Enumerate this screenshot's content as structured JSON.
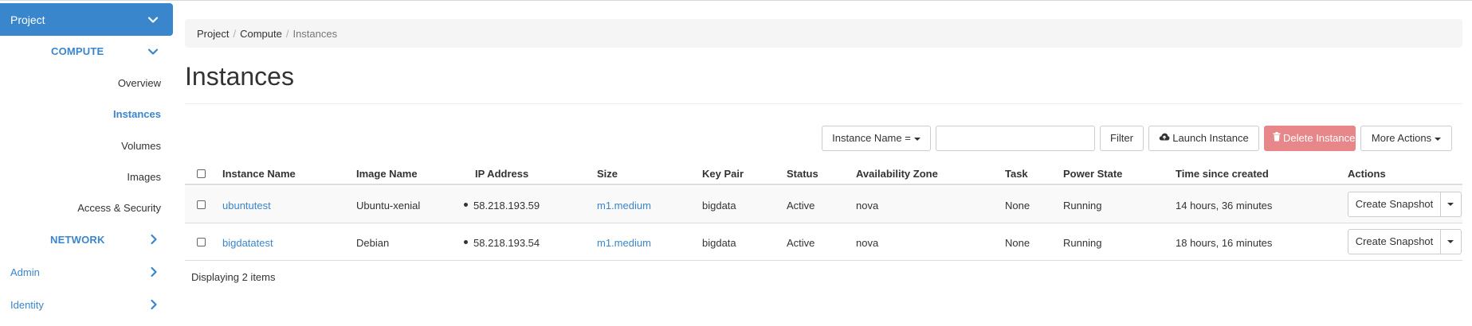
{
  "sidebar": {
    "project_label": "Project",
    "compute_label": "COMPUTE",
    "compute_items": [
      {
        "label": "Overview",
        "active": false
      },
      {
        "label": "Instances",
        "active": true
      },
      {
        "label": "Volumes",
        "active": false
      },
      {
        "label": "Images",
        "active": false
      },
      {
        "label": "Access & Security",
        "active": false
      }
    ],
    "network_label": "NETWORK",
    "admin_label": "Admin",
    "identity_label": "Identity",
    "accent_color": "#3a86cc"
  },
  "breadcrumb": {
    "items": [
      "Project",
      "Compute",
      "Instances"
    ],
    "separator": "/"
  },
  "page": {
    "title": "Instances"
  },
  "toolbar": {
    "filter_field_label": "Instance Name =",
    "search_value": "",
    "filter_label": "Filter",
    "launch_label": "Launch Instance",
    "delete_label": "Delete Instances",
    "more_label": "More Actions",
    "launch_icon": "cloud-upload-icon",
    "delete_icon": "trash-icon",
    "danger_color": "#e7878a"
  },
  "table": {
    "columns": [
      "Instance Name",
      "Image Name",
      "IP Address",
      "Size",
      "Key Pair",
      "Status",
      "Availability Zone",
      "Task",
      "Power State",
      "Time since created",
      "Actions"
    ],
    "rows": [
      {
        "name": "ubuntutest",
        "image": "Ubuntu-xenial",
        "ip": "58.218.193.59",
        "size": "m1.medium",
        "key_pair": "bigdata",
        "status": "Active",
        "zone": "nova",
        "task": "None",
        "power": "Running",
        "age": "14 hours, 36 minutes",
        "action": "Create Snapshot"
      },
      {
        "name": "bigdatatest",
        "image": "Debian",
        "ip": "58.218.193.54",
        "size": "m1.medium",
        "key_pair": "bigdata",
        "status": "Active",
        "zone": "nova",
        "task": "None",
        "power": "Running",
        "age": "18 hours, 16 minutes",
        "action": "Create Snapshot"
      }
    ],
    "footer": "Displaying 2 items"
  }
}
